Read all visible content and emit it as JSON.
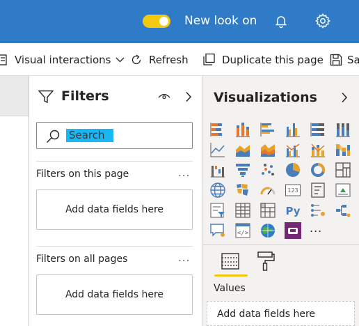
{
  "header": {
    "toggle_on": true,
    "new_look_label": "New look on",
    "accent_color": "#2f7bc7",
    "toggle_color": "#f2c811"
  },
  "command_bar": {
    "visual_interactions": "Visual interactions",
    "refresh": "Refresh",
    "duplicate_page": "Duplicate this page",
    "save_truncated": "Sa"
  },
  "filters": {
    "title": "Filters",
    "search_placeholder": "Search",
    "this_page_label": "Filters on this page",
    "this_page_more": "...",
    "this_page_drop": "Add data fields here",
    "all_pages_label": "Filters on all pages",
    "all_pages_more": "...",
    "all_pages_drop": "Add data fields here"
  },
  "visualizations": {
    "title": "Visualizations",
    "more_label": "...",
    "icons": [
      "stacked-bar-icon",
      "stacked-column-icon",
      "clustered-bar-icon",
      "clustered-column-icon",
      "100-stacked-bar-icon",
      "100-stacked-column-icon",
      "line-chart-icon",
      "area-chart-icon",
      "stacked-area-icon",
      "line-clustered-column-icon",
      "line-stacked-column-icon",
      "ribbon-chart-icon",
      "waterfall-icon",
      "funnel-icon",
      "scatter-icon",
      "pie-chart-icon",
      "donut-icon",
      "treemap-icon",
      "map-icon",
      "filled-map-icon",
      "gauge-icon",
      "card-icon",
      "multi-row-card-icon",
      "kpi-icon",
      "slicer-icon",
      "table-icon",
      "matrix-icon",
      "python-visual-icon",
      "key-influencers-icon",
      "decomposition-tree-icon",
      "qna-icon",
      "r-script-icon",
      "arcgis-map-icon",
      "power-apps-icon"
    ],
    "values_label": "Values",
    "values_drop": "Add data fields here"
  }
}
